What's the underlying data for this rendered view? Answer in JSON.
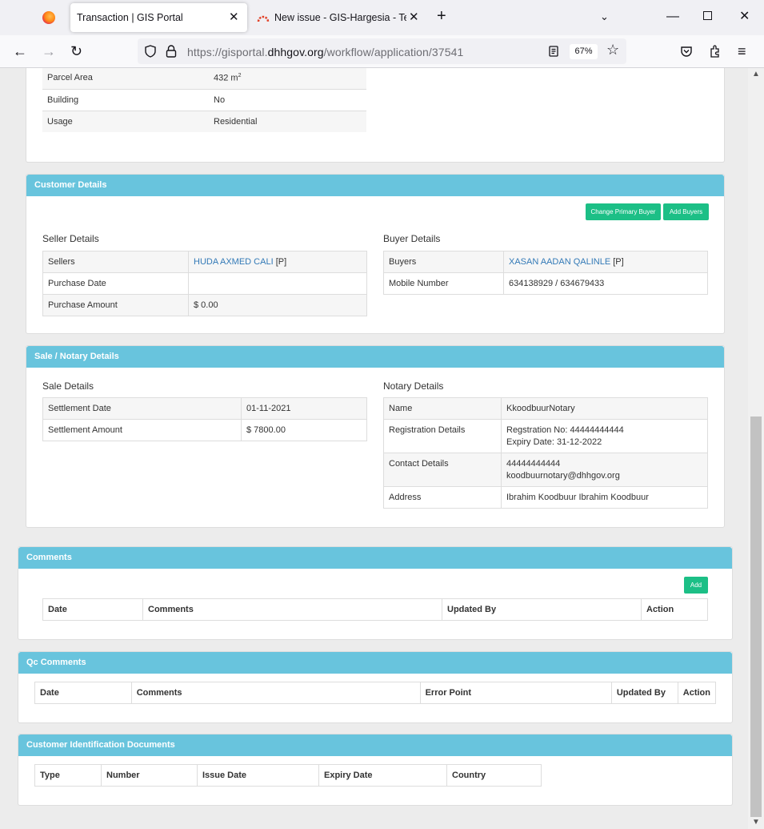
{
  "browser": {
    "active_tab_title": "Transaction | GIS Portal",
    "second_tab_title": "New issue - GIS-Hargesia - Team",
    "url_prefix": "https://gisportal.",
    "url_domain": "dhhgov.org",
    "url_path": "/workflow/application/37541",
    "zoom": "67%"
  },
  "parcel": {
    "rows": [
      {
        "label": "Parcel Area",
        "value": "432 m",
        "sup": "2"
      },
      {
        "label": "Building",
        "value": "No"
      },
      {
        "label": "Usage",
        "value": "Residential"
      }
    ]
  },
  "customer": {
    "header": "Customer Details",
    "change_primary_buyer": "Change Primary Buyer",
    "add_buyers": "Add Buyers",
    "seller_title": "Seller Details",
    "buyer_title": "Buyer Details",
    "sellers_label": "Sellers",
    "sellers_name": "HUDA AXMED CALI",
    "sellers_tag": "[P]",
    "purchase_date_label": "Purchase Date",
    "purchase_date": "",
    "purchase_amount_label": "Purchase Amount",
    "purchase_amount": "$ 0.00",
    "buyers_label": "Buyers",
    "buyers_name": "XASAN AADAN QALINLE",
    "buyers_tag": "[P]",
    "mobile_label": "Mobile Number",
    "mobile": "634138929 / 634679433"
  },
  "sale": {
    "header": "Sale / Notary Details",
    "sale_title": "Sale Details",
    "notary_title": "Notary Details",
    "settlement_date_label": "Settlement Date",
    "settlement_date": "01-11-2021",
    "settlement_amount_label": "Settlement Amount",
    "settlement_amount": "$ 7800.00",
    "name_label": "Name",
    "name": "KkoodbuurNotary",
    "reg_label": "Registration Details",
    "reg_no": "Regstration No: 44444444444",
    "expiry": "Expiry Date: 31-12-2022",
    "contact_label": "Contact Details",
    "phone": "44444444444",
    "email": "koodbuurnotary@dhhgov.org",
    "address_label": "Address",
    "address": "Ibrahim Koodbuur Ibrahim Koodbuur"
  },
  "comments": {
    "header": "Comments",
    "add": "Add",
    "columns": [
      "Date",
      "Comments",
      "Updated By",
      "Action"
    ]
  },
  "qc": {
    "header": "Qc Comments",
    "columns": [
      "Date",
      "Comments",
      "Error Point",
      "Updated By",
      "Action"
    ]
  },
  "docs": {
    "header": "Customer Identification Documents",
    "columns": [
      "Type",
      "Number",
      "Issue Date",
      "Expiry Date",
      "Country"
    ]
  }
}
